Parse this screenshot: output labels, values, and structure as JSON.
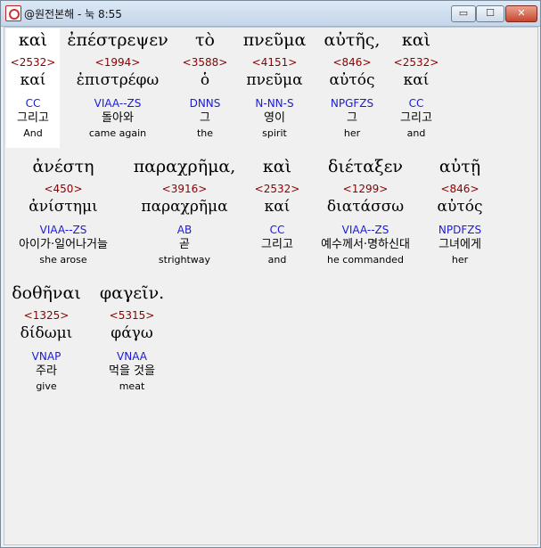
{
  "window": {
    "title": "@원전본해 - 눅 8:55",
    "min_label": "▭",
    "max_label": "☐",
    "close_label": "✕"
  },
  "words": [
    {
      "greek": "καὶ",
      "strong": "<2532>",
      "lemma": "καί",
      "parse": "CC",
      "korean": "그리고",
      "english": "And"
    },
    {
      "greek": "ἐπέστρεψεν",
      "strong": "<1994>",
      "lemma": "ἐπιστρέφω",
      "parse": "VIAA--ZS",
      "korean": "돌아와",
      "english": "came again"
    },
    {
      "greek": "τὸ",
      "strong": "<3588>",
      "lemma": "ὁ",
      "parse": "DNNS",
      "korean": "그",
      "english": "the"
    },
    {
      "greek": "πνεῦμα",
      "strong": "<4151>",
      "lemma": "πνεῦμα",
      "parse": "N-NN-S",
      "korean": "영이",
      "english": "spirit"
    },
    {
      "greek": "αὐτῆς,",
      "strong": "<846>",
      "lemma": "αὐτός",
      "parse": "NPGFZS",
      "korean": "그",
      "english": "her"
    },
    {
      "greek": "καὶ",
      "strong": "<2532>",
      "lemma": "καί",
      "parse": "CC",
      "korean": "그리고",
      "english": "and"
    },
    {
      "greek": "ἀνέστη",
      "strong": "<450>",
      "lemma": "ἀνίστημι",
      "parse": "VIAA--ZS",
      "korean": "아이가·일어나거늘",
      "english": "she arose"
    },
    {
      "greek": "παραχρῆμα,",
      "strong": "<3916>",
      "lemma": "παραχρῆμα",
      "parse": "AB",
      "korean": "곧",
      "english": "strightway"
    },
    {
      "greek": "καὶ",
      "strong": "<2532>",
      "lemma": "καί",
      "parse": "CC",
      "korean": "그리고",
      "english": "and"
    },
    {
      "greek": "διέταξεν",
      "strong": "<1299>",
      "lemma": "διατάσσω",
      "parse": "VIAA--ZS",
      "korean": "예수께서·명하신대",
      "english": "he commanded"
    },
    {
      "greek": "αὐτῇ",
      "strong": "<846>",
      "lemma": "αὐτός",
      "parse": "NPDFZS",
      "korean": "그녀에게",
      "english": "her"
    },
    {
      "greek": "δοθῆναι",
      "strong": "<1325>",
      "lemma": "δίδωμι",
      "parse": "VNAP",
      "korean": "주라",
      "english": "give"
    },
    {
      "greek": "φαγεῖν.",
      "strong": "<5315>",
      "lemma": "φάγω",
      "parse": "VNAA",
      "korean": "먹을 것을",
      "english": "meat"
    }
  ]
}
